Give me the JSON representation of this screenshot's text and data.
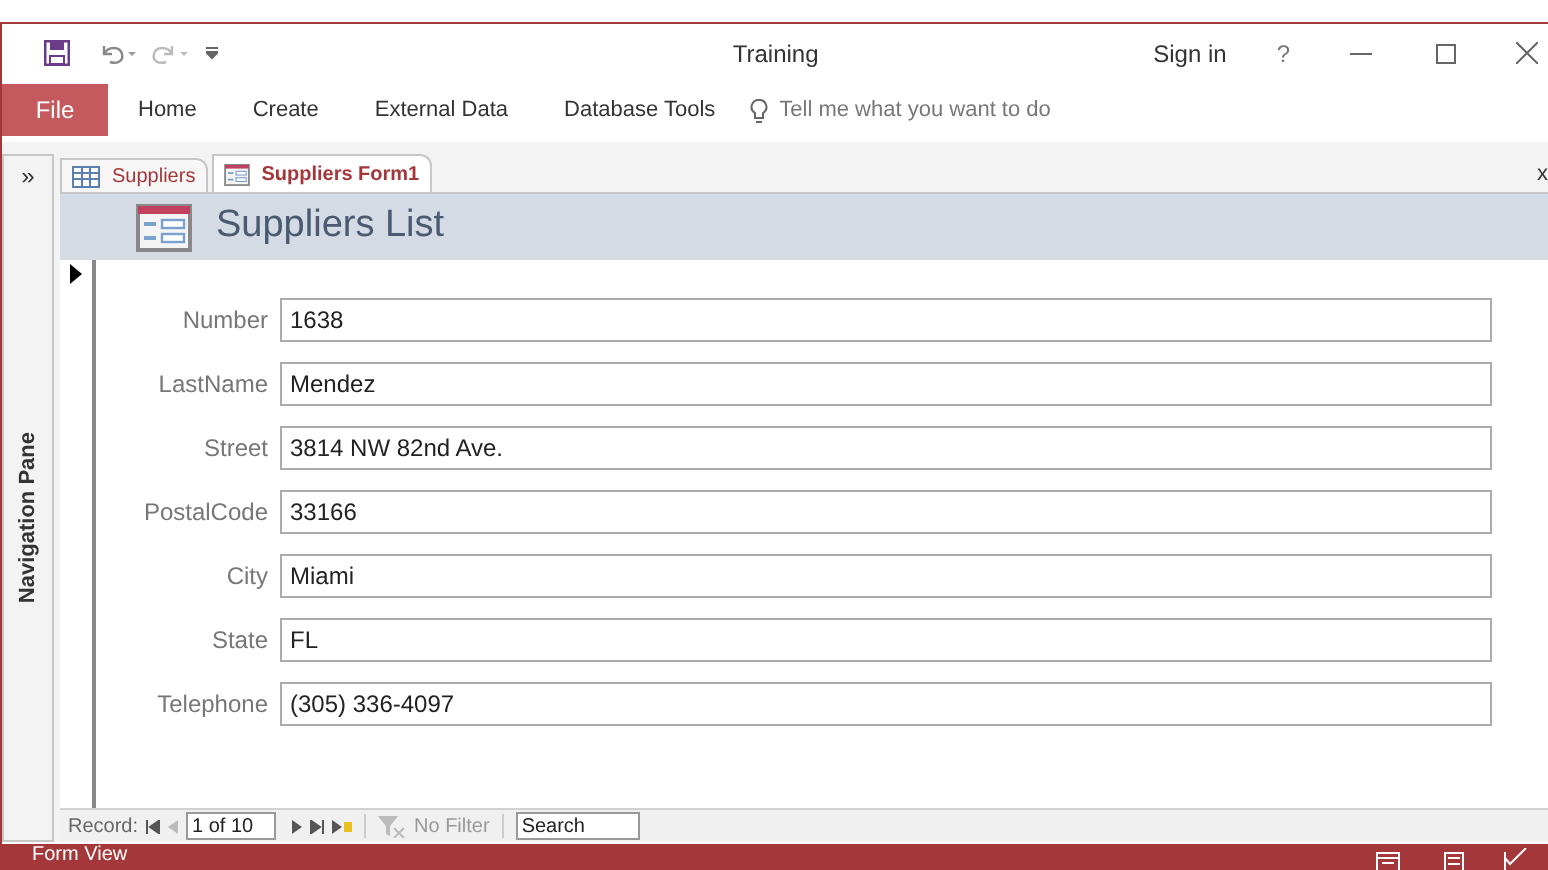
{
  "window": {
    "title": "Training",
    "sign_in": "Sign in",
    "help": "?"
  },
  "ribbon": {
    "tabs": [
      {
        "label": "File",
        "kind": "file"
      },
      {
        "label": "Home",
        "kind": "tab"
      },
      {
        "label": "Create",
        "kind": "tab"
      },
      {
        "label": "External Data",
        "kind": "tab"
      },
      {
        "label": "Database Tools",
        "kind": "tab"
      }
    ],
    "tell_me": {
      "placeholder": "Tell me what you want to do"
    }
  },
  "navigation_pane": {
    "toggle": "»",
    "label": "Navigation Pane"
  },
  "doc_tabs": [
    {
      "label": "Suppliers",
      "kind": "table",
      "selected": false
    },
    {
      "label": "Suppliers Form1",
      "kind": "form",
      "selected": true
    }
  ],
  "doc_close": "x",
  "form": {
    "title": "Suppliers List",
    "fields": [
      {
        "label": "Number",
        "value": "1638"
      },
      {
        "label": "LastName",
        "value": "Mendez"
      },
      {
        "label": "Street",
        "value": "3814 NW 82nd Ave."
      },
      {
        "label": "PostalCode",
        "value": "33166"
      },
      {
        "label": "City",
        "value": "Miami"
      },
      {
        "label": "State",
        "value": "FL"
      },
      {
        "label": "Telephone",
        "value": "(305) 336-4097"
      }
    ]
  },
  "record_nav": {
    "label": "Record:",
    "position": "1 of 10",
    "filter": "No Filter",
    "search": {
      "placeholder": "Search"
    }
  },
  "status_bar": {
    "text": "Form View"
  }
}
